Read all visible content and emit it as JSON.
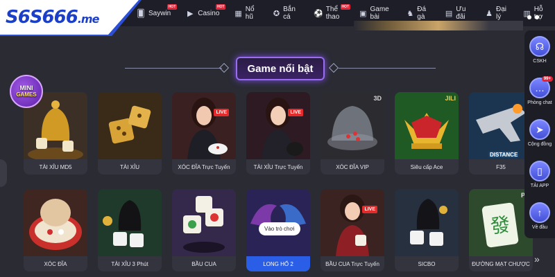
{
  "brand": {
    "logo_main": "S6S666",
    "logo_suffix": ".me",
    "accent": "#2c4fd6"
  },
  "nav": {
    "items": [
      {
        "label": "Saywin",
        "icon": "card-icon",
        "hot": true
      },
      {
        "label": "Casino",
        "icon": "play-icon",
        "hot": true
      },
      {
        "label": "Nổ hũ",
        "icon": "slot-icon",
        "hot": false
      },
      {
        "label": "Bắn cá",
        "icon": "fish-icon",
        "hot": false
      },
      {
        "label": "Thể thao",
        "icon": "ball-icon",
        "hot": true
      },
      {
        "label": "Game bài",
        "icon": "cards-icon",
        "hot": false
      },
      {
        "label": "Đá gà",
        "icon": "rooster-icon",
        "hot": false
      },
      {
        "label": "Ưu đãi",
        "icon": "gift-icon",
        "hot": false
      },
      {
        "label": "Đại lý",
        "icon": "agent-icon",
        "hot": false
      },
      {
        "label": "Hỗ trợ",
        "icon": "support-icon",
        "hot": false
      }
    ],
    "hot_label": "HOT"
  },
  "section": {
    "title": "Game nổi bật"
  },
  "mini_games": {
    "line1": "MINI",
    "line2": "GAMES"
  },
  "games": [
    {
      "label": "TÀI XỈU MD5",
      "art": "bowl-dice"
    },
    {
      "label": "TÀI XỈU",
      "art": "gold-dice"
    },
    {
      "label": "XÓC ĐĨA Trực Tuyến",
      "art": "live-dealer",
      "live": "LIVE"
    },
    {
      "label": "TÀI XỈU Trực Tuyến",
      "art": "live-dealer",
      "live": "LIVE"
    },
    {
      "label": "XÓC ĐĨA VIP",
      "art": "glass-dome",
      "corner": "3D"
    },
    {
      "label": "Siêu cấp Ace",
      "art": "jester-crown",
      "corner": "JILI"
    },
    {
      "label": "F35",
      "art": "fighter-jet",
      "extra": "DISTANCE"
    },
    {
      "label": "XÓC ĐĨA",
      "art": "red-plate"
    },
    {
      "label": "TÀI XỈU 3 Phút",
      "art": "black-cup-dice"
    },
    {
      "label": "BẦU CUA",
      "art": "bau-cua-dice"
    },
    {
      "label": "LONG HỔ 2",
      "art": "dragon-tiger",
      "tooltip": "Vào trò chơi",
      "active": true
    },
    {
      "label": "BẦU CUA Trực Tuyến",
      "art": "live-dealer",
      "live": "LIVE"
    },
    {
      "label": "SICBO",
      "art": "black-cup-dice"
    },
    {
      "label": "ĐƯỜNG MẠT CHƯỢC",
      "art": "mahjong",
      "corner": "PG"
    }
  ],
  "sidebar": [
    {
      "label": "CSKH",
      "icon": "headset-icon"
    },
    {
      "label": "Phòng chat",
      "icon": "chat-icon",
      "badge": "99+"
    },
    {
      "label": "Cộng đồng",
      "icon": "telegram-icon"
    },
    {
      "label": "TẢI APP",
      "icon": "phone-icon"
    },
    {
      "label": "Về đầu",
      "icon": "arrow-up-icon"
    }
  ]
}
